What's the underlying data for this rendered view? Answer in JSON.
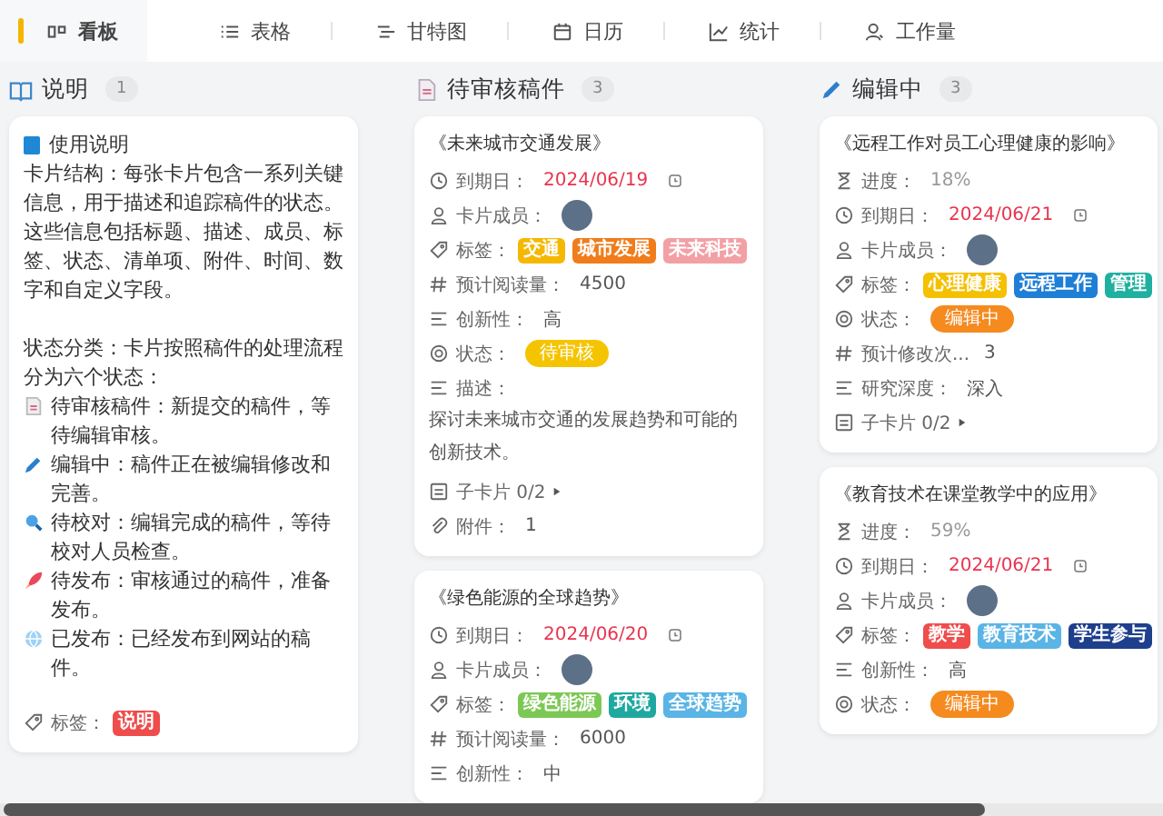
{
  "tabs": [
    {
      "label": "看板",
      "selected": true
    },
    {
      "label": "表格",
      "selected": false
    },
    {
      "label": "甘特图",
      "selected": false
    },
    {
      "label": "日历",
      "selected": false
    },
    {
      "label": "统计",
      "selected": false
    },
    {
      "label": "工作量",
      "selected": false
    }
  ],
  "columns": [
    {
      "title": "说明",
      "count": "1",
      "cards": [
        {
          "kind": "note",
          "heading": "使用说明",
          "paragraphs": [
            "卡片结构：每张卡片包含一系列关键信息，用于描述和追踪稿件的状态。这些信息包括标题、描述、成员、标签、状态、清单项、附件、时间、数字和自定义字段。",
            "状态分类：卡片按照稿件的处理流程分为六个状态："
          ],
          "items": [
            {
              "text": "待审核稿件：新提交的稿件，等待编辑审核。"
            },
            {
              "text": "编辑中：稿件正在被编辑修改和完善。"
            },
            {
              "text": "待校对：编辑完成的稿件，等待校对人员检查。"
            },
            {
              "text": "待发布：审核通过的稿件，准备发布。"
            },
            {
              "text": "已发布：已经发布到网站的稿件。"
            }
          ],
          "fields": [
            {
              "kind": "tags",
              "label": "标签：",
              "tags": [
                {
                  "text": "说明",
                  "color": "#ef4c4c"
                }
              ]
            }
          ]
        }
      ]
    },
    {
      "title": "待审核稿件",
      "count": "3",
      "cards": [
        {
          "kind": "task",
          "title": "《未来城市交通发展》",
          "fields": [
            {
              "kind": "date",
              "label": "到期日：",
              "value": "2024/06/19"
            },
            {
              "kind": "members",
              "label": "卡片成员："
            },
            {
              "kind": "tags",
              "label": "标签：",
              "tags": [
                {
                  "text": "交通",
                  "color": "#f5b800"
                },
                {
                  "text": "城市发展",
                  "color": "#f07c1b"
                },
                {
                  "text": "未来科技",
                  "color": "#f2a0a5"
                }
              ]
            },
            {
              "kind": "number",
              "label": "预计阅读量：",
              "value": "4500"
            },
            {
              "kind": "text",
              "label": "创新性：",
              "value": "高"
            },
            {
              "kind": "status",
              "label": "状态：",
              "value": "待审核",
              "color": "#f5c400"
            },
            {
              "kind": "description",
              "label": "描述：",
              "value": "探讨未来城市交通的发展趋势和可能的创新技术。"
            },
            {
              "kind": "subcards",
              "label": "子卡片 0/2"
            },
            {
              "kind": "attachments",
              "label": "附件：",
              "value": "1"
            }
          ]
        },
        {
          "kind": "task",
          "title": "《绿色能源的全球趋势》",
          "fields": [
            {
              "kind": "date",
              "label": "到期日：",
              "value": "2024/06/20"
            },
            {
              "kind": "members",
              "label": "卡片成员："
            },
            {
              "kind": "tags",
              "label": "标签：",
              "tags": [
                {
                  "text": "绿色能源",
                  "color": "#7cc855"
                },
                {
                  "text": "环境",
                  "color": "#1fa8a0"
                },
                {
                  "text": "全球趋势",
                  "color": "#5ab4e5"
                }
              ]
            },
            {
              "kind": "number",
              "label": "预计阅读量：",
              "value": "6000"
            },
            {
              "kind": "text",
              "label": "创新性：",
              "value": "中"
            }
          ]
        }
      ]
    },
    {
      "title": "编辑中",
      "count": "3",
      "cards": [
        {
          "kind": "task",
          "title": "《远程工作对员工心理健康的影响》",
          "fields": [
            {
              "kind": "progress",
              "label": "进度：",
              "value": "18%"
            },
            {
              "kind": "date",
              "label": "到期日：",
              "value": "2024/06/21"
            },
            {
              "kind": "members",
              "label": "卡片成员："
            },
            {
              "kind": "tags",
              "label": "标签：",
              "tags": [
                {
                  "text": "心理健康",
                  "color": "#f5c000"
                },
                {
                  "text": "远程工作",
                  "color": "#1e7fd6"
                },
                {
                  "text": "管理",
                  "color": "#20b0a0"
                }
              ]
            },
            {
              "kind": "status",
              "label": "状态：",
              "value": "编辑中",
              "color": "#f58a1f"
            },
            {
              "kind": "number",
              "label": "预计修改次...",
              "value": "3"
            },
            {
              "kind": "text",
              "label": "研究深度：",
              "value": "深入"
            },
            {
              "kind": "subcards",
              "label": "子卡片 0/2"
            }
          ]
        },
        {
          "kind": "task",
          "title": "《教育技术在课堂教学中的应用》",
          "fields": [
            {
              "kind": "progress",
              "label": "进度：",
              "value": "59%"
            },
            {
              "kind": "date",
              "label": "到期日：",
              "value": "2024/06/21"
            },
            {
              "kind": "members",
              "label": "卡片成员："
            },
            {
              "kind": "tags",
              "label": "标签：",
              "tags": [
                {
                  "text": "教学",
                  "color": "#ef4c4c"
                },
                {
                  "text": "教育技术",
                  "color": "#5ab4e5"
                },
                {
                  "text": "学生参与",
                  "color": "#1d3f8c"
                }
              ]
            },
            {
              "kind": "text",
              "label": "创新性：",
              "value": "高"
            },
            {
              "kind": "status",
              "label": "状态：",
              "value": "编辑中",
              "color": "#f58a1f"
            }
          ]
        }
      ]
    }
  ]
}
